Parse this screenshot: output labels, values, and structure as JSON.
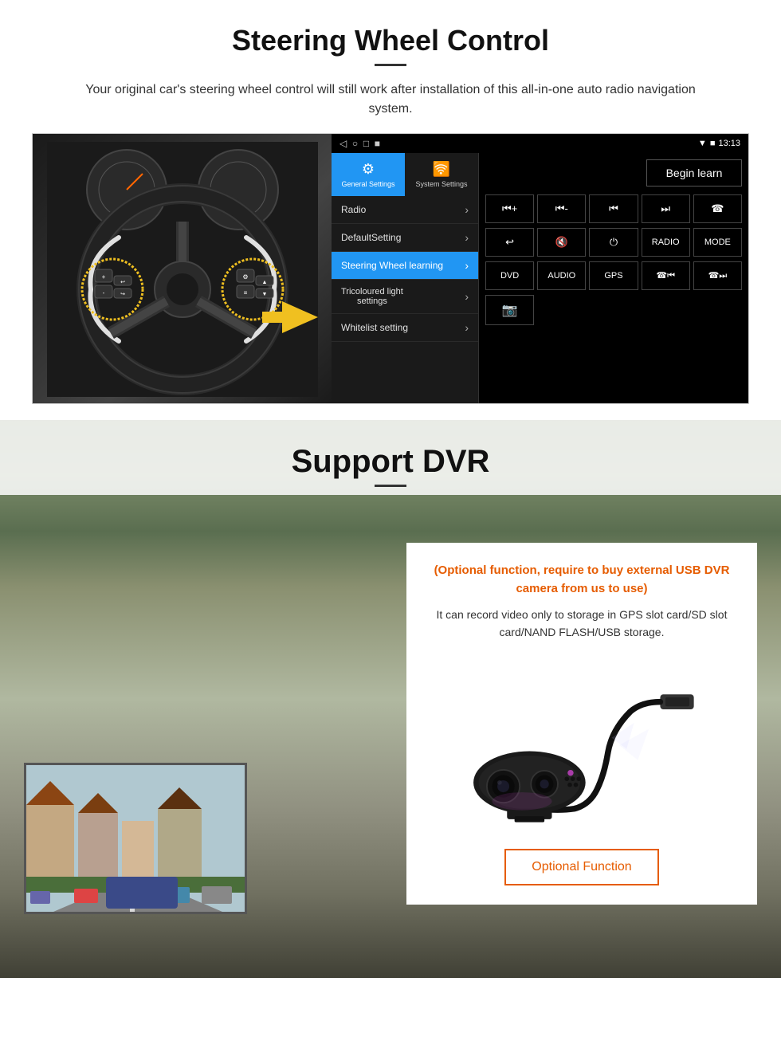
{
  "steering": {
    "title": "Steering Wheel Control",
    "description": "Your original car's steering wheel control will still work after installation of this all-in-one auto radio navigation system.",
    "ui": {
      "statusbar": {
        "time": "13:13",
        "signal": "▼",
        "wifi": "▾",
        "battery": "■"
      },
      "navbar_icons": [
        "◁",
        "○",
        "□",
        "■"
      ],
      "tabs": [
        {
          "label": "General Settings",
          "icon": "⚙",
          "active": true
        },
        {
          "label": "System Settings",
          "icon": "🛜",
          "active": false
        }
      ],
      "menu_items": [
        {
          "label": "Radio",
          "active": false
        },
        {
          "label": "DefaultSetting",
          "active": false
        },
        {
          "label": "Steering Wheel learning",
          "active": true
        },
        {
          "label": "Tricoloured light settings",
          "active": false
        },
        {
          "label": "Whitelist setting",
          "active": false
        }
      ],
      "begin_learn": "Begin learn",
      "control_buttons_row1": [
        "⏮+",
        "⏮-",
        "⏮",
        "⏭",
        "☎"
      ],
      "control_buttons_row2": [
        "↩",
        "🔇",
        "⏻",
        "RADIO",
        "MODE"
      ],
      "control_buttons_row3": [
        "DVD",
        "AUDIO",
        "GPS",
        "☎⏮",
        "☎⏭"
      ],
      "control_buttons_row4": [
        "📷"
      ]
    }
  },
  "dvr": {
    "title": "Support DVR",
    "optional_text": "(Optional function, require to buy external USB DVR camera from us to use)",
    "description": "It can record video only to storage in GPS slot card/SD slot card/NAND FLASH/USB storage.",
    "optional_function_label": "Optional Function"
  }
}
